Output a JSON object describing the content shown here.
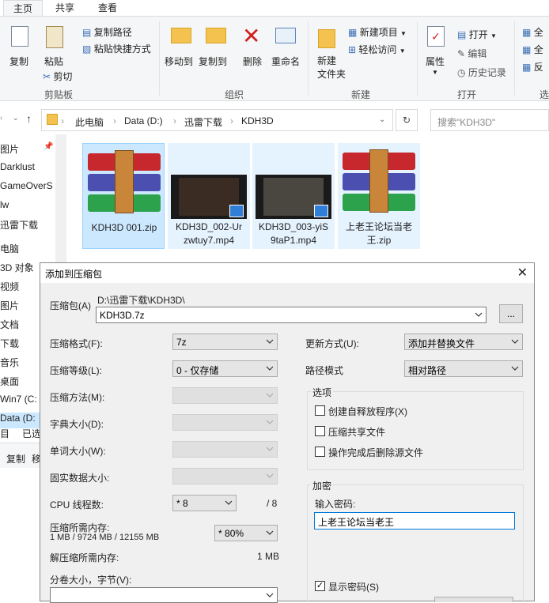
{
  "ribbon": {
    "tabs": [
      "主页",
      "共享",
      "查看"
    ],
    "clipboard": {
      "copy": "复制",
      "paste": "粘贴",
      "copy_path": "复制路径",
      "paste_shortcut": "粘贴快捷方式",
      "cut": "剪切",
      "group": "剪贴板"
    },
    "organize": {
      "move_to": "移动到",
      "copy_to": "复制到",
      "delete": "删除",
      "rename": "重命名",
      "group": "组织"
    },
    "new": {
      "new_folder_line1": "新建",
      "new_folder_line2": "文件夹",
      "new_item": "新建项目",
      "easy_access": "轻松访问",
      "group": "新建"
    },
    "open": {
      "properties": "属性",
      "open": "打开",
      "edit": "编辑",
      "history": "历史记录",
      "group": "打开"
    },
    "select": {
      "select_all": "全",
      "select_none": "全",
      "invert": "反",
      "group": "选"
    }
  },
  "address": {
    "crumbs": [
      "此电脑",
      "Data (D:)",
      "迅雷下载",
      "KDH3D"
    ],
    "search_placeholder": "搜索\"KDH3D\""
  },
  "nav": {
    "items": [
      "图片",
      "Darklust",
      "GameOverS",
      "lw",
      "迅雷下载",
      "电脑",
      "3D 对象",
      "视频",
      "图片",
      "文档",
      "下载",
      "音乐",
      "桌面",
      "Win7 (C:",
      "Data (D:"
    ]
  },
  "status": {
    "items": "目",
    "selected": "已选",
    "copy": "复制",
    "move": "移"
  },
  "files": [
    {
      "name_l1": "KDH3D 001.zip",
      "name_l2": "",
      "type": "zip"
    },
    {
      "name_l1": "KDH3D_002-Ur",
      "name_l2": "zwtuy7.mp4",
      "type": "video"
    },
    {
      "name_l1": "KDH3D_003-yiS",
      "name_l2": "9taP1.mp4",
      "type": "video"
    },
    {
      "name_l1": "上老王论坛当老",
      "name_l2": "王.zip",
      "type": "zip"
    }
  ],
  "dialog": {
    "title": "添加到压缩包",
    "archive_label": "压缩包(A)",
    "archive_path": "D:\\迅雷下载\\KDH3D\\",
    "archive_name": "KDH3D.7z",
    "browse": "...",
    "format_label": "压缩格式(F):",
    "format_value": "7z",
    "level_label": "压缩等级(L):",
    "level_value": "0 - 仅存储",
    "method_label": "压缩方法(M):",
    "dict_label": "字典大小(D):",
    "word_label": "单词大小(W):",
    "solid_label": "固实数据大小:",
    "threads_label": "CPU 线程数:",
    "threads_value": "8",
    "threads_max": "/ 8",
    "mem_comp_label": "压缩所需内存:",
    "mem_comp_detail": "1 MB / 9724 MB / 12155 MB",
    "mem_percent": "80%",
    "mem_decomp_label": "解压缩所需内存:",
    "mem_decomp_value": "1 MB",
    "volume_label": "分卷大小，字节(V):",
    "update_label": "更新方式(U):",
    "update_value": "添加并替换文件",
    "path_label": "路径模式",
    "path_value": "相对路径",
    "options_title": "选项",
    "opt_sfx": "创建自释放程序(X)",
    "opt_shared": "压缩共享文件",
    "opt_delete": "操作完成后删除源文件",
    "enc_title": "加密",
    "pwd_label": "输入密码:",
    "pwd_value": "上老王论坛当老王",
    "show_pwd": "显示密码(S)"
  }
}
